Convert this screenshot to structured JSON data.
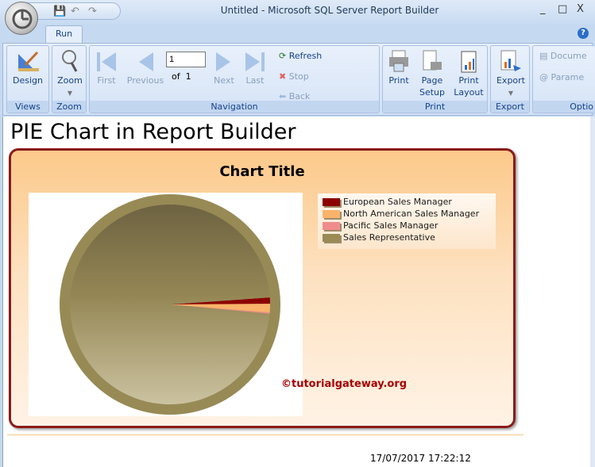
{
  "window": {
    "title": "Untitled - Microsoft SQL Server Report Builder",
    "min": "_",
    "max": "□",
    "close": "X"
  },
  "tabs": [
    {
      "label": "Run"
    }
  ],
  "ribbon": {
    "views": {
      "label": "Views",
      "design": "Design"
    },
    "zoom": {
      "label": "Zoom",
      "zoom": "Zoom"
    },
    "navigation": {
      "label": "Navigation",
      "first": "First",
      "previous": "Previous",
      "page_value": "1",
      "of": "of",
      "total": "1",
      "next": "Next",
      "last": "Last",
      "refresh": "Refresh",
      "stop": "Stop",
      "back": "Back"
    },
    "print": {
      "label": "Print",
      "print": "Print",
      "page_setup_1": "Page",
      "page_setup_2": "Setup",
      "print_layout_1": "Print",
      "print_layout_2": "Layout"
    },
    "export": {
      "label": "Export",
      "export": "Export"
    },
    "options": {
      "label": "Optio",
      "document": "Docume",
      "parameters": "Parame"
    }
  },
  "report": {
    "title": "PIE Chart in Report Builder",
    "watermark": "©tutorialgateway.org",
    "timestamp": "17/07/2017 17:22:12"
  },
  "chart_data": {
    "type": "pie",
    "title": "Chart Title",
    "legend_position": "top-right",
    "categories": [
      "European Sales Manager",
      "North American Sales Manager",
      "Pacific Sales Manager",
      "Sales Representative"
    ],
    "values": [
      1.0,
      1.4,
      0.2,
      97.4
    ],
    "colors": [
      "#8b0000",
      "#f9b36a",
      "#f08c8c",
      "#9a8b55"
    ]
  }
}
